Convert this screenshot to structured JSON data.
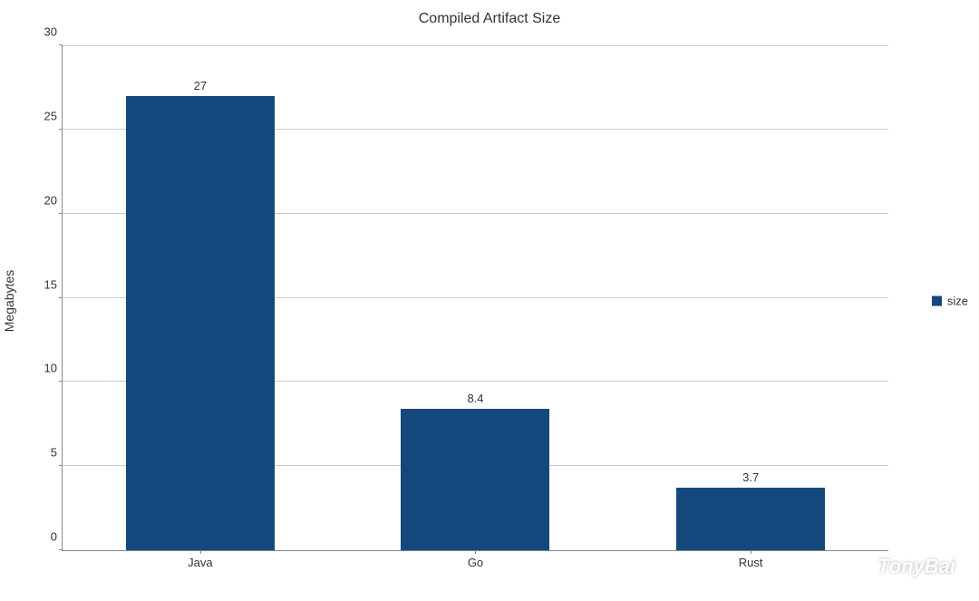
{
  "chart_data": {
    "type": "bar",
    "title": "Compiled Artifact Size",
    "ylabel": "Megabytes",
    "xlabel": "",
    "categories": [
      "Java",
      "Go",
      "Rust"
    ],
    "values": [
      27,
      8.4,
      3.7
    ],
    "value_labels": [
      "27",
      "8.4",
      "3.7"
    ],
    "ylim": [
      0,
      30
    ],
    "y_ticks": [
      0,
      5,
      10,
      15,
      20,
      25,
      30
    ],
    "series_name": "size",
    "bar_color": "#14487d"
  },
  "watermark": {
    "text": "TonyBai"
  }
}
